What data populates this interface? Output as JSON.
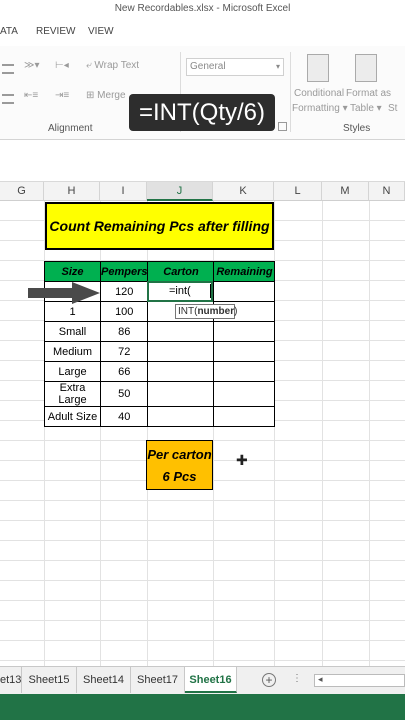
{
  "window": {
    "title": "New Recordables.xlsx - Microsoft Excel"
  },
  "ribbon_tabs": [
    "ATA",
    "REVIEW",
    "VIEW"
  ],
  "ribbon": {
    "wrap_text": "Wrap Text",
    "merge": "Merge",
    "number_format": "General",
    "conditional_formatting_1": "Conditional",
    "conditional_formatting_2": "Formatting",
    "format_as_table_1": "Format as",
    "format_as_table_2": "Table",
    "cell_styles": "St",
    "alignment_label": "Alignment",
    "styles_label": "Styles"
  },
  "overlay_formula": "=INT(Qty/6)",
  "columns": [
    "G",
    "H",
    "I",
    "J",
    "K",
    "L",
    "M",
    "N"
  ],
  "title_cell": "Count Remaining Pcs after filling",
  "table": {
    "headers": [
      "Size",
      "Pempers",
      "Carton",
      "Remaining"
    ],
    "rows": [
      [
        "",
        "120"
      ],
      [
        "1",
        "100"
      ],
      [
        "Small",
        "86"
      ],
      [
        "Medium",
        "72"
      ],
      [
        "Large",
        "66"
      ],
      [
        "Extra Large",
        "50"
      ],
      [
        "Adult Size",
        "40"
      ]
    ]
  },
  "active_cell_text": "=int(",
  "tooltip": {
    "fn": "INT(",
    "arg": "number",
    "close": ")"
  },
  "per_carton": {
    "line1": "Per carton",
    "line2": "6 Pcs"
  },
  "sheet_tabs": [
    "et13",
    "Sheet15",
    "Sheet14",
    "Sheet17",
    "Sheet16"
  ],
  "active_sheet": "Sheet16",
  "colors": {
    "excel_green": "#217346",
    "header_green": "#00b050",
    "title_yellow": "#ffff00",
    "carton_orange": "#ffc000"
  }
}
